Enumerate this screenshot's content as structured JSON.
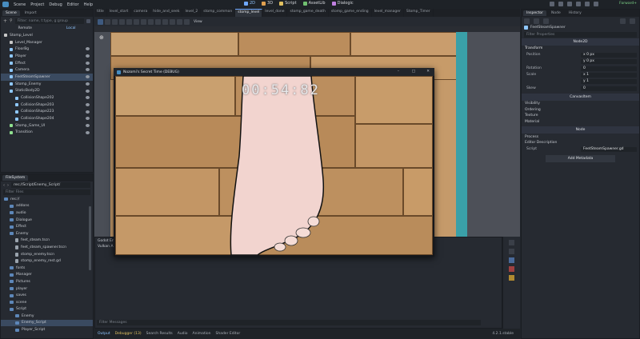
{
  "menu": {
    "items": [
      "Scene",
      "Project",
      "Debug",
      "Editor",
      "Help"
    ]
  },
  "center_menu": [
    {
      "label": "2D",
      "active": true,
      "color": "#6fa8ff"
    },
    {
      "label": "3D",
      "active": false,
      "color": "#e0a050"
    },
    {
      "label": "Script",
      "active": false,
      "color": "#e0c060"
    },
    {
      "label": "AssetLib",
      "active": false,
      "color": "#70c070"
    },
    {
      "label": "Dialogic",
      "active": false,
      "color": "#c080e0"
    }
  ],
  "renderer": "Forward+",
  "scene_panel": {
    "tabs": [
      "Scene",
      "Import"
    ],
    "filter_placeholder": "Filter: name, t:type, g:group",
    "remote_label": "Remote",
    "local_label": "Local",
    "tree": [
      {
        "label": "Stomp_Level",
        "indent": 0,
        "color": "#c8c8c8",
        "sel": false
      },
      {
        "label": "Level_Manager",
        "indent": 1,
        "color": "#c8c8c8",
        "sel": false
      },
      {
        "label": "FloorBg",
        "indent": 1,
        "color": "#8fc8ff",
        "sel": false
      },
      {
        "label": "Player",
        "indent": 1,
        "color": "#8fc8ff",
        "sel": false
      },
      {
        "label": "Effect",
        "indent": 1,
        "color": "#8fc8ff",
        "sel": false
      },
      {
        "label": "Camera",
        "indent": 1,
        "color": "#8fc8ff",
        "sel": false
      },
      {
        "label": "FeetSteamSpawner",
        "indent": 1,
        "color": "#8fc8ff",
        "sel": true
      },
      {
        "label": "Stomp_Enemy",
        "indent": 1,
        "color": "#8fc8ff",
        "sel": false
      },
      {
        "label": "StaticBody2D",
        "indent": 1,
        "color": "#8fc8ff",
        "sel": false
      },
      {
        "label": "CollisionShape202",
        "indent": 2,
        "color": "#8fc8ff",
        "sel": false
      },
      {
        "label": "CollisionShape203",
        "indent": 2,
        "color": "#8fc8ff",
        "sel": false
      },
      {
        "label": "CollisionShape223",
        "indent": 2,
        "color": "#8fc8ff",
        "sel": false
      },
      {
        "label": "CollisionShape204",
        "indent": 2,
        "color": "#8fc8ff",
        "sel": false
      },
      {
        "label": "Stomp_Game_UI",
        "indent": 1,
        "color": "#8fe08f",
        "sel": false
      },
      {
        "label": "Transition",
        "indent": 1,
        "color": "#8fe08f",
        "sel": false
      }
    ]
  },
  "filesystem": {
    "tab": "FileSystem",
    "path": "res://Script/Enemy_Script/",
    "filter_placeholder": "Filter Files",
    "items": [
      {
        "label": "res://",
        "type": "folder",
        "indent": 0,
        "sel": false
      },
      {
        "label": "addons",
        "type": "folder",
        "indent": 1,
        "sel": false
      },
      {
        "label": "audio",
        "type": "folder",
        "indent": 1,
        "sel": false
      },
      {
        "label": "Dialogue",
        "type": "folder",
        "indent": 1,
        "sel": false
      },
      {
        "label": "Effect",
        "type": "folder",
        "indent": 1,
        "sel": false
      },
      {
        "label": "Enemy",
        "type": "folder",
        "indent": 1,
        "sel": false
      },
      {
        "label": "feet_steam.tscn",
        "type": "file",
        "indent": 2,
        "sel": false
      },
      {
        "label": "feet_steam_spawner.tscn",
        "type": "file",
        "indent": 2,
        "sel": false
      },
      {
        "label": "stomp_enemy.tscn",
        "type": "file",
        "indent": 2,
        "sel": false
      },
      {
        "label": "stomp_enemy_rest.gd",
        "type": "file",
        "indent": 2,
        "sel": false
      },
      {
        "label": "fonts",
        "type": "folder",
        "indent": 1,
        "sel": false
      },
      {
        "label": "Manager",
        "type": "folder",
        "indent": 1,
        "sel": false
      },
      {
        "label": "Pictures",
        "type": "folder",
        "indent": 1,
        "sel": false
      },
      {
        "label": "player",
        "type": "folder",
        "indent": 1,
        "sel": false
      },
      {
        "label": "saves",
        "type": "folder",
        "indent": 1,
        "sel": false
      },
      {
        "label": "scene",
        "type": "folder",
        "indent": 1,
        "sel": false
      },
      {
        "label": "Script",
        "type": "folder",
        "indent": 1,
        "sel": false
      },
      {
        "label": "Enemy",
        "type": "folder",
        "indent": 2,
        "sel": false
      },
      {
        "label": "Enemy_Script",
        "type": "folder",
        "indent": 2,
        "sel": true
      },
      {
        "label": "Player_Script",
        "type": "folder",
        "indent": 2,
        "sel": false
      }
    ]
  },
  "editor_tabs": [
    "title",
    "level_start",
    "camera",
    "hide_and_seek",
    "level_2",
    "stomp_common",
    "stomp_level",
    "level_done",
    "stomp_game_death",
    "stomp_game_ending",
    "level_manager",
    "Stomp_Timer"
  ],
  "active_tab_index": 6,
  "viewport": {
    "view_label": "View"
  },
  "game_window": {
    "title": "Nozomi's Secret Time (DEBUG)",
    "timer": "00:54:82",
    "controls": [
      "–",
      "□",
      "✕"
    ]
  },
  "output_panel": {
    "lines": [
      "Godot En",
      "Vulkan A"
    ],
    "filter_placeholder": "Filter Messages",
    "tabs": [
      "Output",
      "Debugger (13)",
      "Search Results",
      "Audio",
      "Animation",
      "Shader Editor"
    ],
    "version": "4.2.1.stable"
  },
  "inspector": {
    "tabs": [
      "Inspector",
      "Node",
      "History"
    ],
    "node_name": "FeetSteamSpawner",
    "filter_placeholder": "Filter Properties",
    "class_header": "Node2D",
    "transform_label": "Transform",
    "props": [
      {
        "label": "Position",
        "value": "x  0 px"
      },
      {
        "label": "",
        "value": "y  0 px"
      },
      {
        "label": "Rotation",
        "value": "0"
      },
      {
        "label": "Scale",
        "value": "x  1"
      },
      {
        "label": "",
        "value": "y  1"
      },
      {
        "label": "Skew",
        "value": "0"
      }
    ],
    "canvas_header": "CanvasItem",
    "canvas_sections": [
      "Visibility",
      "Ordering",
      "Texture",
      "Material"
    ],
    "node_header": "Node",
    "node_sections": [
      "Process",
      "Editor Description"
    ],
    "script_label": "Script",
    "script_value": "FeetSteamSpawner.gd",
    "add_metadata": "Add Metadata"
  }
}
